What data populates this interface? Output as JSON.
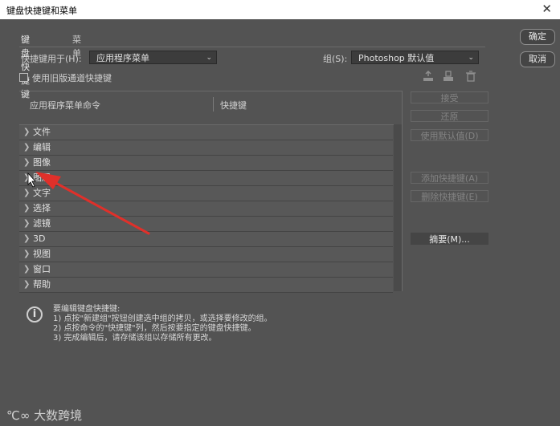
{
  "window": {
    "title": "键盘快捷键和菜单",
    "close_glyph": "✕"
  },
  "buttons": {
    "ok": "确定",
    "cancel": "取消"
  },
  "tabs": [
    {
      "label": "键盘快捷键"
    },
    {
      "label": "菜单"
    }
  ],
  "shortcuts_for": {
    "label": "快捷键用于(H):",
    "value": "应用程序菜单"
  },
  "set": {
    "label": "组(S):",
    "value": "Photoshop 默认值"
  },
  "legacy_channel": {
    "label": "使用旧版通道快捷键",
    "checked": false
  },
  "table": {
    "col_command": "应用程序菜单命令",
    "col_shortcut": "快捷键",
    "rows": [
      {
        "label": "文件"
      },
      {
        "label": "编辑"
      },
      {
        "label": "图像"
      },
      {
        "label": "图层"
      },
      {
        "label": "文字"
      },
      {
        "label": "选择"
      },
      {
        "label": "滤镜"
      },
      {
        "label": "3D"
      },
      {
        "label": "视图"
      },
      {
        "label": "窗口"
      },
      {
        "label": "帮助"
      }
    ]
  },
  "side_buttons": {
    "accept": "接受",
    "undo": "还原",
    "use_default": "使用默认值(D)",
    "add_shortcut": "添加快捷键(A)",
    "delete_shortcut": "删除快捷键(E)",
    "summarize": "摘要(M)..."
  },
  "info": {
    "heading": "要编辑键盘快捷键:",
    "step1": "1) 点按\"新建组\"按钮创建选中组的拷贝，或选择要修改的组。",
    "step2": "2) 点按命令的\"快捷键\"列，然后按要指定的键盘快捷键。",
    "step3": "3) 完成编辑后，请存储该组以存储所有更改。"
  },
  "watermark": {
    "text": "大数跨境"
  },
  "colors": {
    "background": "#535353",
    "annotation_arrow": "#e0302a"
  }
}
